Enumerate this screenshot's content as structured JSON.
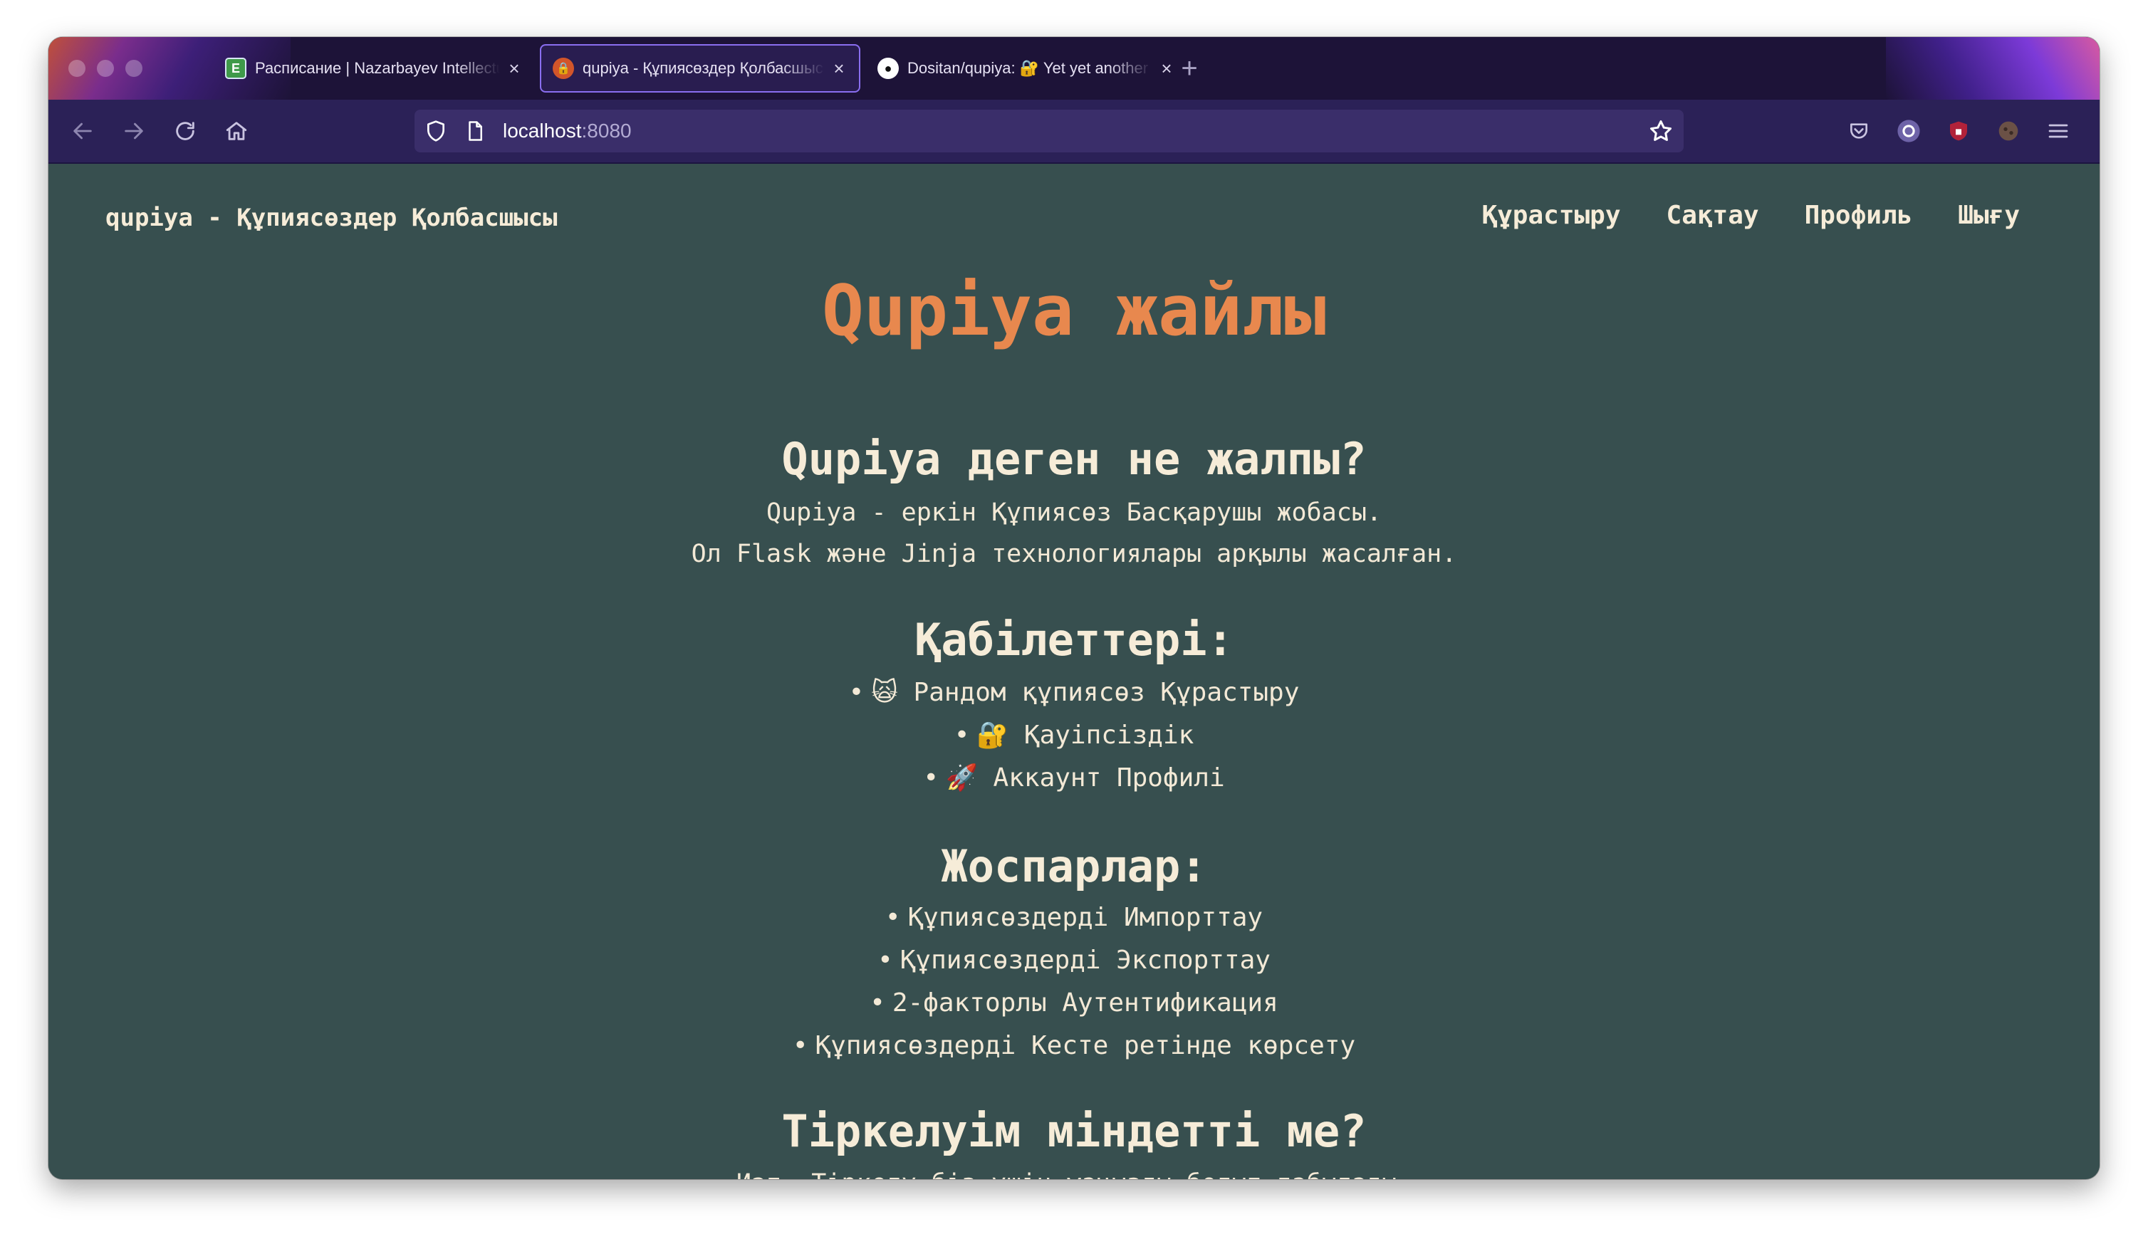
{
  "browser": {
    "tabs": [
      {
        "title": "Расписание | Nazarbayev Intellectual Schools",
        "favicon": "spreadsheet-icon",
        "active": false
      },
      {
        "title": "qupiya - Құпиясөздер Қолбасшысы",
        "favicon": "lock-icon",
        "active": true
      },
      {
        "title": "Dositan/qupiya: 🔐 Yet yet another password manager",
        "favicon": "github-icon",
        "active": false
      }
    ],
    "url_host": "localhost",
    "url_port": ":8080",
    "accent_color": "#8a6ef0"
  },
  "site": {
    "brand": "qupiya - Құпиясөздер Қолбасшысы",
    "nav": [
      "Құрастыру",
      "Сақтау",
      "Профиль",
      "Шығу"
    ]
  },
  "page": {
    "title": "Qupiya жайлы",
    "title_color": "#e8884e",
    "background_color": "#374f4f",
    "about": {
      "heading": "Qupiya деген не жалпы?",
      "lines": [
        "Qupiya - еркін Құпиясөз Басқарушы жобасы.",
        "Ол Flask және Jinja технологиялары арқылы жасалған."
      ]
    },
    "features": {
      "heading": "Қабілеттері:",
      "items": [
        {
          "emoji": "🙀",
          "text": "Рандом құпиясөз Құрастыру"
        },
        {
          "emoji": "🔐",
          "text": "Қауіпсіздік"
        },
        {
          "emoji": "🚀",
          "text": "Аккаунт Профилі"
        }
      ]
    },
    "plans": {
      "heading": "Жоспарлар:",
      "items": [
        "Құпиясөздерді Импорттау",
        "Құпиясөздерді Экспорттау",
        "2-факторлы Аутентификация",
        "Құпиясөздерді Кесте ретінде көрсету"
      ]
    },
    "registration": {
      "heading": "Тіркелуім міндетті ме?",
      "lines": [
        "Иәп. Тіркелу біз үшін маңызды болып табылады,"
      ]
    }
  }
}
